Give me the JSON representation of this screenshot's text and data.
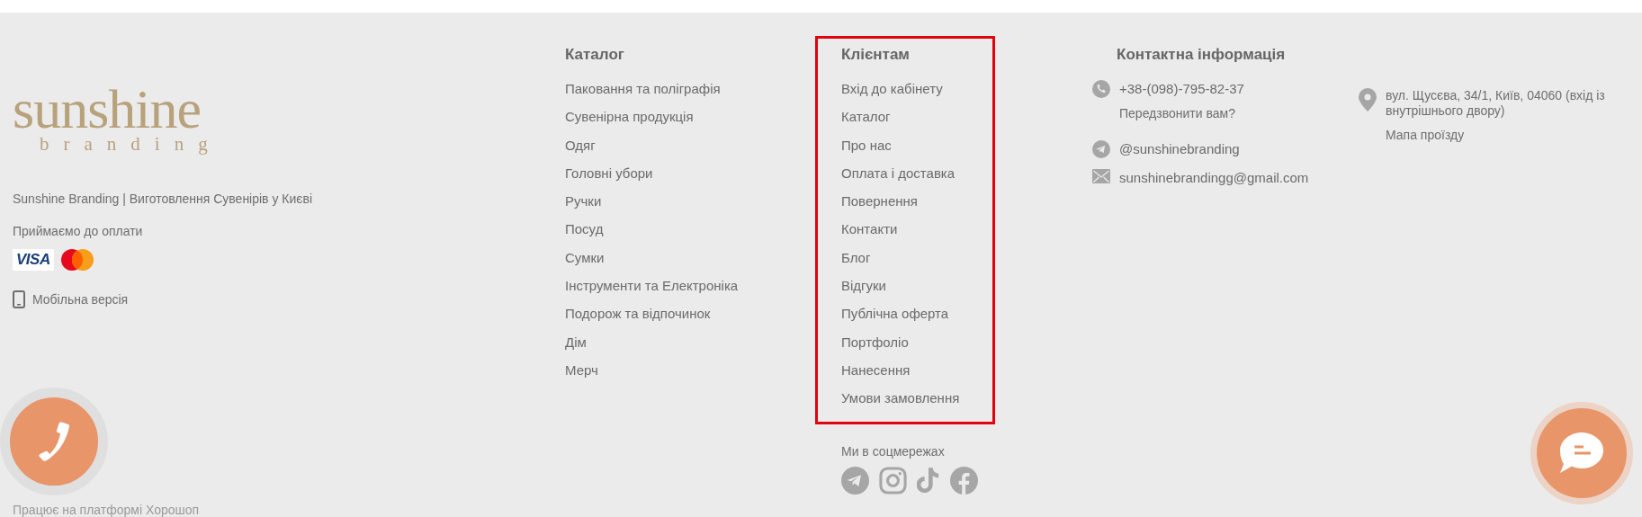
{
  "brand": {
    "logo_main": "sunshine",
    "logo_sub": "branding",
    "tagline": "Sunshine Branding | Виготовлення Сувенірів у Києві",
    "payment_label": "Приймаємо до оплати",
    "payments": [
      {
        "kind": "visa",
        "label": "VISA"
      },
      {
        "kind": "mastercard"
      }
    ],
    "mobile_link": "Мобільна версія"
  },
  "columns": [
    {
      "title": "Каталог",
      "highlighted": false,
      "items": [
        "Паковання та поліграфія",
        "Сувенірна продукція",
        "Одяг",
        "Головні убори",
        "Ручки",
        "Посуд",
        "Сумки",
        "Інструменти та Електроніка",
        "Подорож та відпочинок",
        "Дім",
        "Мерч"
      ]
    },
    {
      "title": "Клієнтам",
      "highlighted": true,
      "items": [
        "Вхід до кабінету",
        "Каталог",
        "Про нас",
        "Оплата і доставка",
        "Повернення",
        "Контакти",
        "Блог",
        "Відгуки",
        "Публічна оферта",
        "Портфоліо",
        "Нанесення",
        "Умови замовлення"
      ]
    }
  ],
  "social": {
    "label": "Ми в соцмережах",
    "links": [
      {
        "kind": "telegram"
      },
      {
        "kind": "instagram"
      },
      {
        "kind": "tiktok"
      },
      {
        "kind": "facebook"
      }
    ]
  },
  "contacts": {
    "title": "Контактна інформація",
    "items": [
      {
        "kind": "phone",
        "text": "+38-(098)-795-82-37",
        "link": "Передзвонити вам?"
      },
      {
        "kind": "telegram",
        "text": "@sunshinebranding"
      },
      {
        "kind": "email",
        "text": "sunshinebrandingg@gmail.com"
      }
    ],
    "address": {
      "text": "вул. Щусєва, 34/1, Київ, 04060 (вхід із внутрішнього двору)",
      "link": "Мапа проїзду"
    }
  },
  "platform_note": "Працює на платформі Хорошоп",
  "floating": [
    {
      "kind": "call"
    },
    {
      "kind": "chat"
    }
  ]
}
